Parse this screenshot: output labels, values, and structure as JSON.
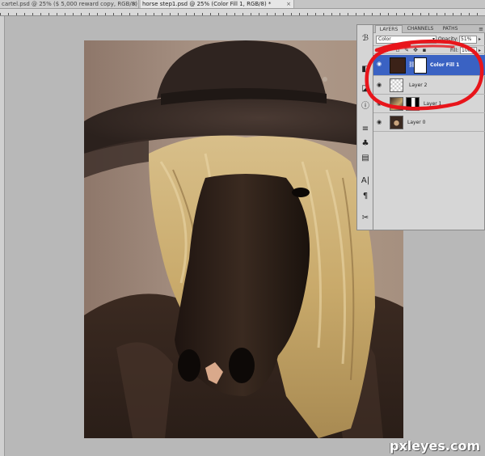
{
  "document_tabs": [
    {
      "label": "cartel.psd @ 25% ($ 5,000 reward copy, RGB/8)",
      "close": "×"
    },
    {
      "label": "horse step1.psd @ 25% (Color Fill 1, RGB/8) *",
      "close": "×"
    }
  ],
  "panel": {
    "tabs": [
      "LAYERS",
      "CHANNELS",
      "PATHS"
    ],
    "menu_icon": "panel-menu-icon",
    "blend_mode": "Color",
    "opacity_label": "Opacity:",
    "opacity_value": "51%",
    "lock_label": "Lock:",
    "fill_label": "Fill:",
    "fill_value": "100%",
    "layers": [
      {
        "name": "Color Fill 1",
        "selected": true
      },
      {
        "name": "Layer 2",
        "selected": false
      },
      {
        "name": "Layer 1",
        "selected": false
      },
      {
        "name": "Layer 0",
        "selected": false
      }
    ]
  },
  "colors": {
    "selection": "#3a62c3",
    "annotation": "#e8151b",
    "color_fill_swatch": "#3b2218"
  },
  "watermark": "pxleyes.com"
}
